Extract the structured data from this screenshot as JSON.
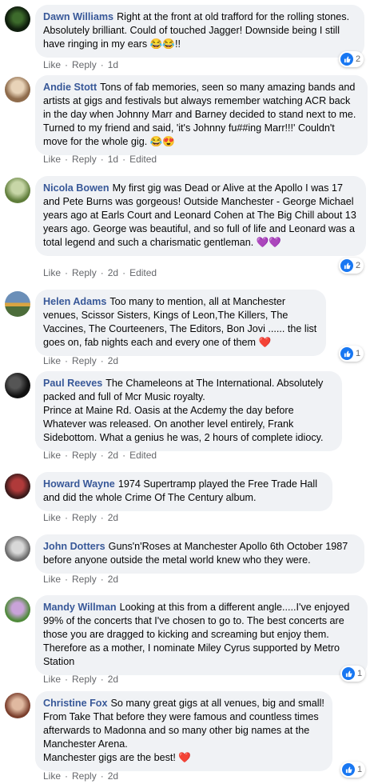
{
  "colors": {
    "name": "#385898",
    "bubble": "#f0f2f5",
    "like": "#1877f2",
    "meta": "#65676b"
  },
  "comments": [
    {
      "name": "Dawn Williams",
      "text": "Right at the front at old trafford for the rolling stones. Absolutely brilliant. Could of touched Jagger! Downside being I still have ringing in my ears 😂😂!!",
      "like": "Like",
      "reply": "Reply",
      "time": "1d",
      "edited": "",
      "reactions": "2"
    },
    {
      "name": "Andie Stott",
      "text": "Tons of fab memories, seen so many amazing bands and artists at gigs and festivals but always remember watching ACR back in the day when Johnny Marr and Barney decided to stand next to me. Turned to my friend and said, 'it's Johnny fu##ing Marr!!!' Couldn't move for the whole gig. 😂😍",
      "like": "Like",
      "reply": "Reply",
      "time": "1d",
      "edited": "Edited",
      "reactions": ""
    },
    {
      "name": "Nicola Bowen",
      "text": "My first gig was Dead or Alive at the Apollo I was 17 and Pete Burns was gorgeous! Outside Manchester - George Michael years ago at Earls Court and Leonard Cohen at The Big Chill about 13 years ago. George was beautiful, and so full of life and Leonard was a total legend and such a charismatic gentleman. 💜💜",
      "like": "Like",
      "reply": "Reply",
      "time": "2d",
      "edited": "Edited",
      "reactions": "2"
    },
    {
      "name": "Helen Adams",
      "text": "Too many to mention, all at Manchester venues, Scissor Sisters, Kings of Leon,The Killers, The Vaccines, The Courteeners, The Editors, Bon Jovi ...... the list goes on, fab nights each and every one of them ❤️",
      "like": "Like",
      "reply": "Reply",
      "time": "2d",
      "edited": "",
      "reactions": "1"
    },
    {
      "name": "Paul Reeves",
      "text": "The Chameleons at The International. Absolutely packed and full of Mcr Music royalty.\nPrince at Maine Rd. Oasis at the Acdemy the day before Whatever was released. On another level entirely, Frank Sidebottom. What a genius he was, 2 hours of complete idiocy.",
      "like": "Like",
      "reply": "Reply",
      "time": "2d",
      "edited": "Edited",
      "reactions": ""
    },
    {
      "name": "Howard Wayne",
      "text": "1974 Supertramp played the Free Trade Hall and did the whole Crime Of The Century album.",
      "like": "Like",
      "reply": "Reply",
      "time": "2d",
      "edited": "",
      "reactions": ""
    },
    {
      "name": "John Dotters",
      "text": "Guns'n'Roses at Manchester Apollo 6th October 1987 before anyone outside the metal world knew who they were.",
      "like": "Like",
      "reply": "Reply",
      "time": "2d",
      "edited": "",
      "reactions": ""
    },
    {
      "name": "Mandy Willman",
      "text": "Looking at this from a different angle.....I've enjoyed 99% of the concerts that I've chosen to go to. The best concerts are those you are dragged to kicking and screaming but enjoy them. Therefore as a mother, I nominate Miley Cyrus supported by Metro Station",
      "like": "Like",
      "reply": "Reply",
      "time": "2d",
      "edited": "",
      "reactions": "1"
    },
    {
      "name": "Christine Fox",
      "text": "So many great gigs at all venues, big and small! From Take That before they were famous and countless times afterwards to Madonna and so many other big names at the Manchester Arena.\nManchester gigs are the best! ❤️",
      "like": "Like",
      "reply": "Reply",
      "time": "2d",
      "edited": "",
      "reactions": "1"
    }
  ]
}
